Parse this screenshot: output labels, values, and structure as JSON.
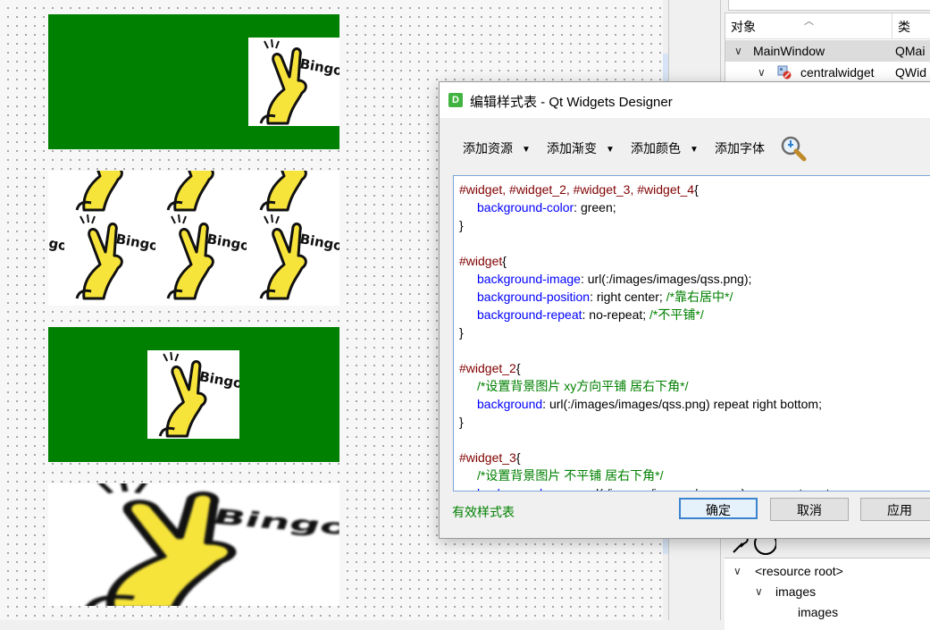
{
  "colors": {
    "widget_bg": "#008000",
    "selector": "#800000",
    "property": "#0000ff",
    "comment": "#008000"
  },
  "object_inspector": {
    "col_object": "对象",
    "col_class": "类",
    "rows": [
      {
        "name": "MainWindow",
        "class": "QMai"
      },
      {
        "name": "centralwidget",
        "class": "QWid"
      }
    ]
  },
  "resource_browser": {
    "rows": [
      "<resource root>",
      "images",
      "images"
    ]
  },
  "dialog": {
    "title": "编辑样式表 - Qt Widgets Designer",
    "app_icon": "D",
    "toolbar": {
      "add_resource": "添加资源",
      "add_gradient": "添加渐变",
      "add_color": "添加颜色",
      "add_font": "添加字体"
    },
    "code_lines": [
      [
        {
          "t": "sel",
          "v": "#widget, #widget_2, #widget_3, #widget_4"
        },
        {
          "t": "val",
          "v": "{"
        }
      ],
      [
        {
          "t": "ind"
        },
        {
          "t": "prop",
          "v": "background-color"
        },
        {
          "t": "val",
          "v": ": green;"
        }
      ],
      [
        {
          "t": "val",
          "v": "}"
        }
      ],
      [],
      [
        {
          "t": "sel",
          "v": "#widget"
        },
        {
          "t": "val",
          "v": "{"
        }
      ],
      [
        {
          "t": "ind"
        },
        {
          "t": "prop",
          "v": "background-image"
        },
        {
          "t": "val",
          "v": ": url(:/images/images/qss.png);"
        }
      ],
      [
        {
          "t": "ind"
        },
        {
          "t": "prop",
          "v": "background-position"
        },
        {
          "t": "val",
          "v": ": right center; "
        },
        {
          "t": "cmt",
          "v": "/*靠右居中*/"
        }
      ],
      [
        {
          "t": "ind"
        },
        {
          "t": "prop",
          "v": "background-repeat"
        },
        {
          "t": "val",
          "v": ": no-repeat; "
        },
        {
          "t": "cmt",
          "v": "/*不平铺*/"
        }
      ],
      [
        {
          "t": "val",
          "v": "}"
        }
      ],
      [],
      [
        {
          "t": "sel",
          "v": "#widget_2"
        },
        {
          "t": "val",
          "v": "{"
        }
      ],
      [
        {
          "t": "ind"
        },
        {
          "t": "cmt",
          "v": "/*设置背景图片 xy方向平铺 居右下角*/"
        }
      ],
      [
        {
          "t": "ind"
        },
        {
          "t": "prop",
          "v": "background"
        },
        {
          "t": "val",
          "v": ": url(:/images/images/qss.png) repeat right bottom;"
        }
      ],
      [
        {
          "t": "val",
          "v": "}"
        }
      ],
      [],
      [
        {
          "t": "sel",
          "v": "#widget_3"
        },
        {
          "t": "val",
          "v": "{"
        }
      ],
      [
        {
          "t": "ind"
        },
        {
          "t": "cmt",
          "v": "/*设置背景图片 不平铺 居右下角*/"
        }
      ],
      [
        {
          "t": "ind"
        },
        {
          "t": "prop",
          "v": "background"
        },
        {
          "t": "val",
          "v": ": green url(:/images/images/qss.png) no-repeat center;"
        }
      ]
    ],
    "valid_label": "有效样式表",
    "ok_label": "确定",
    "cancel_label": "取消",
    "apply_label": "应用"
  },
  "sticker_text": "Bingo"
}
